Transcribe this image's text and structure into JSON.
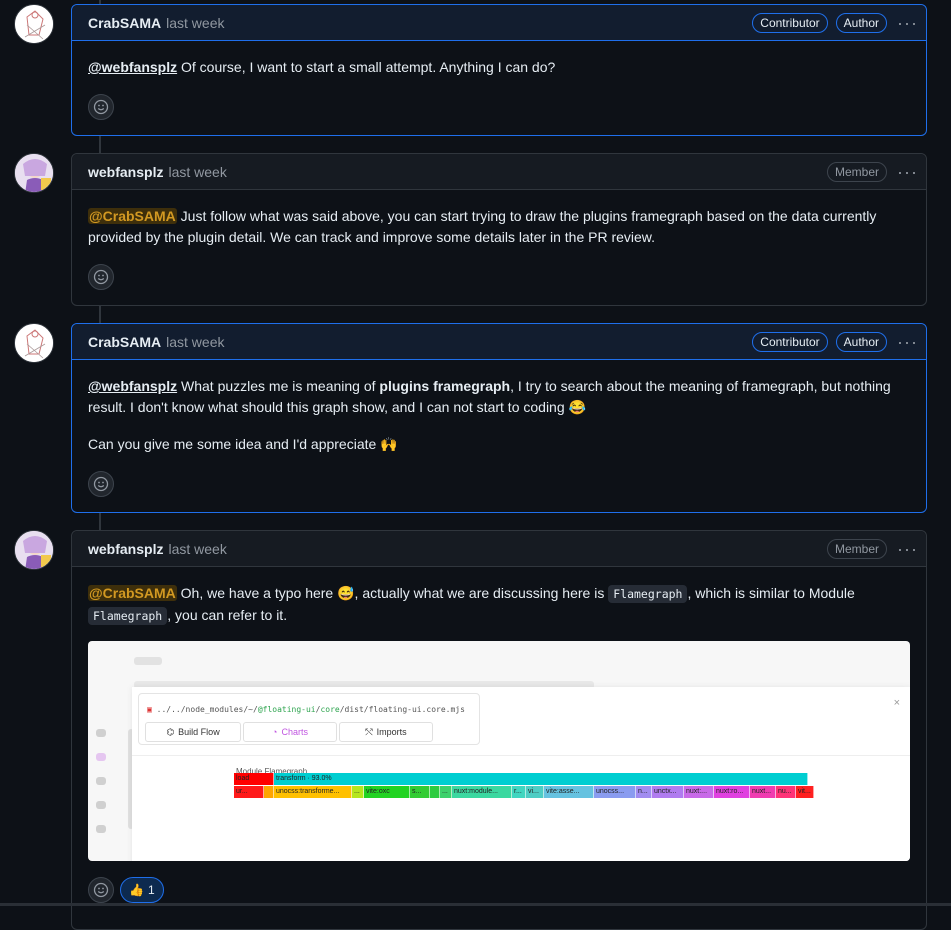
{
  "comments": [
    {
      "user": "CrabSAMA",
      "time": "last week",
      "badges": [
        "Contributor",
        "Author"
      ],
      "more": "···",
      "body": {
        "mention": "@webfansplz",
        "text": " Of course, I want to start a small attempt. Anything I can do?"
      }
    },
    {
      "user": "webfansplz",
      "time": "last week",
      "badges": [
        "Member"
      ],
      "more": "···",
      "body": {
        "mention": "@CrabSAMA",
        "text": " Just follow what was said above, you can start trying to draw the plugins framegraph based on the data currently provided by the plugin detail. We can track and improve some details later in the PR review."
      }
    },
    {
      "user": "CrabSAMA",
      "time": "last week",
      "badges": [
        "Contributor",
        "Author"
      ],
      "more": "···",
      "body": {
        "mention": "@webfansplz",
        "text_a": " What puzzles me is meaning of ",
        "bold": "plugins framegraph",
        "text_b": ", I try to search about the meaning of framegraph, but nothing result. I don't know what should this graph show, and I can not start to coding ",
        "emoji_a": "😂",
        "para2": "Can you give me some idea and I'd appreciate ",
        "emoji_b": "🙌"
      }
    },
    {
      "user": "webfansplz",
      "time": "last week",
      "badges": [
        "Member"
      ],
      "more": "···",
      "body": {
        "mention": "@CrabSAMA",
        "text_a": " Oh, we have a typo here ",
        "emoji": "😅",
        "text_b": ", actually what we are discussing here is ",
        "code1": "Flamegraph",
        "text_c": ", which is similar to Module ",
        "code2": "Flamegraph",
        "text_d": ", you can refer to it."
      },
      "reaction": {
        "emoji": "👍",
        "count": "1"
      }
    }
  ],
  "screenshot": {
    "path_prefix": "../../node_modules/",
    "path_tilde": "~/",
    "path_pkg": "@floating-ui",
    "path_sep1": "/",
    "path_core": "core",
    "path_rest": "/dist/floating-ui.core.mjs",
    "buttons": [
      "Build Flow",
      "Charts",
      "Imports"
    ],
    "flamegraph_label": "Module Flamegraph",
    "close": "×",
    "row1": [
      {
        "label": "load",
        "color": "#ff0000",
        "w": 40
      },
      {
        "label": "transform · 93.0%",
        "color": "#00ced1",
        "w": 534
      }
    ],
    "row2": [
      {
        "label": "ur...",
        "color": "#ff1a1a",
        "w": 30
      },
      {
        "label": "",
        "color": "#ffa500",
        "w": 10
      },
      {
        "label": "unocss:transforme...",
        "color": "#ffc000",
        "w": 78
      },
      {
        "label": "...",
        "color": "#b5e61d",
        "w": 12
      },
      {
        "label": "vite:oxc",
        "color": "#22d322",
        "w": 46
      },
      {
        "label": "s...",
        "color": "#33cc33",
        "w": 20
      },
      {
        "label": "",
        "color": "#2ecc40",
        "w": 10
      },
      {
        "label": "...",
        "color": "#3dd16c",
        "w": 12
      },
      {
        "label": "nuxt:module...",
        "color": "#3bd8a0",
        "w": 60
      },
      {
        "label": "r...",
        "color": "#40d6c0",
        "w": 14
      },
      {
        "label": "vi...",
        "color": "#4ecdc4",
        "w": 18
      },
      {
        "label": "vite:asse...",
        "color": "#66c2e0",
        "w": 50
      },
      {
        "label": "unocss...",
        "color": "#8a9cf0",
        "w": 42
      },
      {
        "label": "n...",
        "color": "#a18cf0",
        "w": 16
      },
      {
        "label": "unctx...",
        "color": "#b07cf0",
        "w": 32
      },
      {
        "label": "nuxt:...",
        "color": "#c86ae8",
        "w": 30
      },
      {
        "label": "nuxt:ro...",
        "color": "#e040e0",
        "w": 36
      },
      {
        "label": "nuxt...",
        "color": "#f03cb0",
        "w": 26
      },
      {
        "label": "nu...",
        "color": "#ff3377",
        "w": 20
      },
      {
        "label": "vit...",
        "color": "#ff2020",
        "w": 18
      }
    ]
  }
}
